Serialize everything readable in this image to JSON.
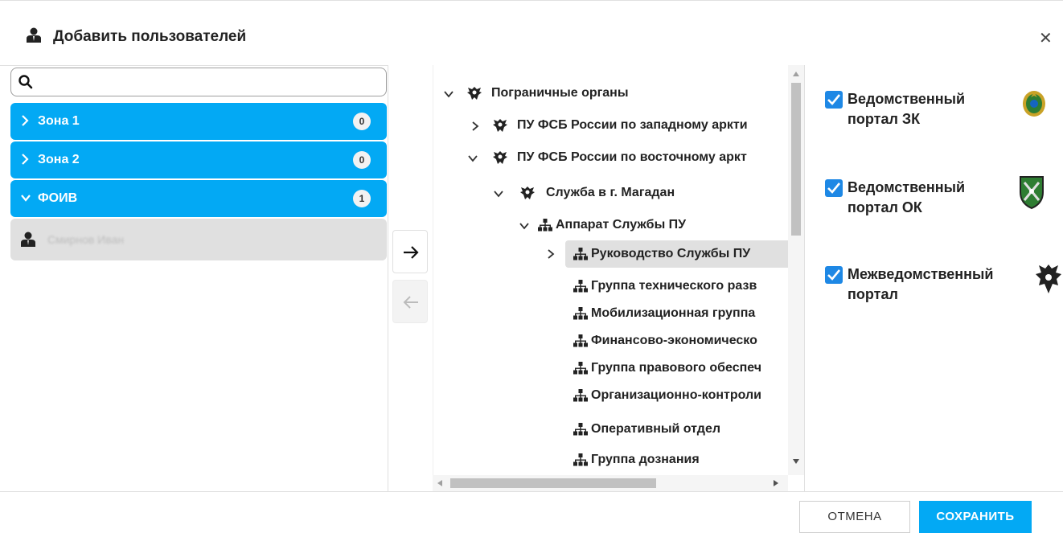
{
  "dialog": {
    "title": "Добавить пользователей",
    "close_icon": "close-icon"
  },
  "search": {
    "value": "",
    "placeholder": ""
  },
  "groups": [
    {
      "label": "Зона 1",
      "count": "0",
      "expanded": false
    },
    {
      "label": "Зона 2",
      "count": "0",
      "expanded": false
    },
    {
      "label": "ФОИВ",
      "count": "1",
      "expanded": true
    }
  ],
  "member": {
    "name": "Смирнов Иван"
  },
  "transfer": {
    "add_icon": "arrow-right-icon",
    "remove_icon": "arrow-left-icon"
  },
  "tree": [
    {
      "label": "Пограничные органы",
      "icon": "eagle-emblem-icon",
      "toggle": "expanded"
    },
    {
      "label": "ПУ ФСБ России по западному аркти",
      "icon": "eagle-emblem-icon",
      "toggle": "collapsed"
    },
    {
      "label": "ПУ ФСБ России по восточному аркт",
      "icon": "eagle-emblem-icon",
      "toggle": "expanded"
    },
    {
      "label": "Служба в г. Магадан",
      "icon": "eagle-emblem-icon",
      "toggle": "expanded"
    },
    {
      "label": "Аппарат Службы ПУ",
      "icon": "org-structure-icon",
      "toggle": "expanded"
    },
    {
      "label": "Руководство Службы ПУ",
      "icon": "org-structure-icon",
      "toggle": "collapsed",
      "selected": true
    },
    {
      "label": "Группа технического разв",
      "icon": "org-structure-icon",
      "toggle": "none"
    },
    {
      "label": "Мобилизационная группа",
      "icon": "org-structure-icon",
      "toggle": "none"
    },
    {
      "label": "Финансово-экономическо",
      "icon": "org-structure-icon",
      "toggle": "none"
    },
    {
      "label": "Группа правового обеспеч",
      "icon": "org-structure-icon",
      "toggle": "none"
    },
    {
      "label": "Организационно-контроли",
      "icon": "org-structure-icon",
      "toggle": "none"
    },
    {
      "label": "Оперативный отдел",
      "icon": "org-structure-icon",
      "toggle": "none"
    },
    {
      "label": "Группа дознания",
      "icon": "org-structure-icon",
      "toggle": "none"
    }
  ],
  "portals": [
    {
      "line1": "Ведомственный",
      "line2": "портал ЗК",
      "checked": true,
      "emblem": "border-guard-emblem-icon"
    },
    {
      "line1": "Ведомственный",
      "line2": "портал ОК",
      "checked": true,
      "emblem": "green-shield-emblem-icon"
    },
    {
      "line1": "Межведомственный",
      "line2": "портал",
      "checked": true,
      "emblem": "double-eagle-emblem-icon"
    }
  ],
  "footer": {
    "cancel_label": "ОТМЕНА",
    "save_label": "СОХРАНИТЬ"
  },
  "colors": {
    "accent": "#03a9f4",
    "checkbox": "#1e88e5",
    "selected_row": "#e0e0e0"
  }
}
